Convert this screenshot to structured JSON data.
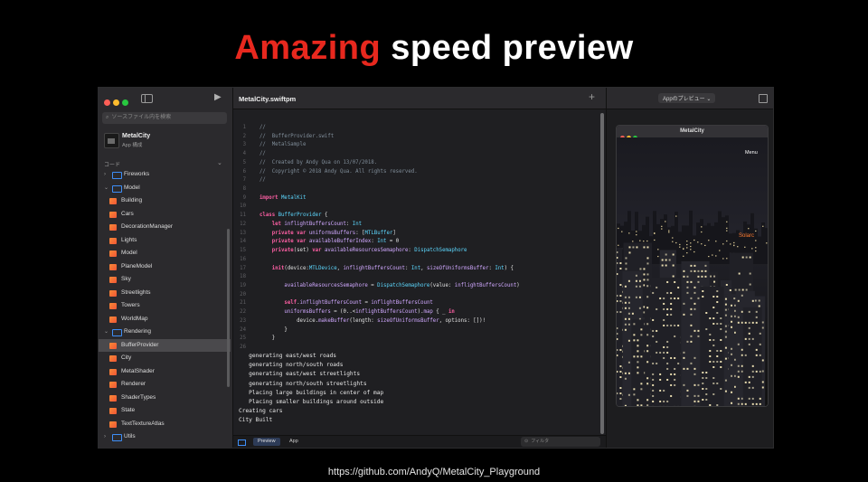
{
  "slide": {
    "title_accent": "Amazing",
    "title_rest": "speed preview",
    "footer_url": "https://github.com/AndyQ/MetalCity_Playground"
  },
  "sidebar": {
    "search_placeholder": "ソースファイル内を検索",
    "project_name": "MetalCity",
    "project_subtitle": "App 構成",
    "section_label": "コード",
    "items": [
      {
        "label": "Fireworks",
        "kind": "folder",
        "level": 1,
        "expanded": false
      },
      {
        "label": "Model",
        "kind": "folder",
        "level": 1,
        "expanded": true
      },
      {
        "label": "Building",
        "kind": "swift",
        "level": 2
      },
      {
        "label": "Cars",
        "kind": "swift",
        "level": 2
      },
      {
        "label": "DecorationManager",
        "kind": "swift",
        "level": 2
      },
      {
        "label": "Lights",
        "kind": "swift",
        "level": 2
      },
      {
        "label": "Model",
        "kind": "swift",
        "level": 2
      },
      {
        "label": "PlaneModel",
        "kind": "swift",
        "level": 2
      },
      {
        "label": "Sky",
        "kind": "swift",
        "level": 2
      },
      {
        "label": "Streetlights",
        "kind": "swift",
        "level": 2
      },
      {
        "label": "Towers",
        "kind": "swift",
        "level": 2
      },
      {
        "label": "WorldMap",
        "kind": "swift",
        "level": 2
      },
      {
        "label": "Rendering",
        "kind": "folder",
        "level": 1,
        "expanded": true
      },
      {
        "label": "BufferProvider",
        "kind": "swift",
        "level": 2,
        "selected": true
      },
      {
        "label": "City",
        "kind": "swift",
        "level": 2
      },
      {
        "label": "MetalShader",
        "kind": "swift",
        "level": 2
      },
      {
        "label": "Renderer",
        "kind": "swift",
        "level": 2
      },
      {
        "label": "ShaderTypes",
        "kind": "swift",
        "level": 2
      },
      {
        "label": "State",
        "kind": "swift",
        "level": 2
      },
      {
        "label": "TextTextureAtlas",
        "kind": "swift",
        "level": 2
      },
      {
        "label": "Utils",
        "kind": "folder",
        "level": 1,
        "expanded": false
      }
    ]
  },
  "editor": {
    "title": "MetalCity.swiftpm",
    "lines": [
      {
        "n": "1",
        "t": "//",
        "c": "cm"
      },
      {
        "n": "2",
        "t": "//  BufferProvider.swift",
        "c": "cm"
      },
      {
        "n": "3",
        "t": "//  MetalSample",
        "c": "cm"
      },
      {
        "n": "4",
        "t": "//",
        "c": "cm"
      },
      {
        "n": "5",
        "t": "//  Created by Andy Qua on 13/07/2018.",
        "c": "cm"
      },
      {
        "n": "6",
        "t": "//  Copyright © 2018 Andy Qua. All rights reserved.",
        "c": "cm"
      },
      {
        "n": "7",
        "t": "//",
        "c": "cm"
      },
      {
        "n": "8",
        "t": "",
        "c": ""
      },
      {
        "n": "9",
        "t": "import MetalKit",
        "c": "import"
      },
      {
        "n": "10",
        "t": "",
        "c": ""
      },
      {
        "n": "11",
        "t": "class BufferProvider {",
        "c": "class"
      },
      {
        "n": "12",
        "t": "    let inflightBuffersCount: Int",
        "c": "let"
      },
      {
        "n": "13",
        "t": "    private var uniformsBuffers: [MTLBuffer]",
        "c": "pv1"
      },
      {
        "n": "14",
        "t": "    private var availableBufferIndex: Int = 0",
        "c": "pv2"
      },
      {
        "n": "15",
        "t": "    private(set) var availableResourcesSemaphore: DispatchSemaphore",
        "c": "pv3"
      },
      {
        "n": "16",
        "t": "",
        "c": ""
      },
      {
        "n": "17",
        "t": "    init(device:MTLDevice, inflightBuffersCount: Int, sizeOfUniformsBuffer: Int) {",
        "c": "init"
      },
      {
        "n": "18",
        "t": "",
        "c": ""
      },
      {
        "n": "19",
        "t": "        availableResourcesSemaphore = DispatchSemaphore(value: inflightBuffersCount)",
        "c": "sem"
      },
      {
        "n": "20",
        "t": "",
        "c": ""
      },
      {
        "n": "21",
        "t": "        self.inflightBuffersCount = inflightBuffersCount",
        "c": "self"
      },
      {
        "n": "22",
        "t": "        uniformsBuffers = (0..<inflightBuffersCount).map { _ in",
        "c": "map"
      },
      {
        "n": "23",
        "t": "            device.makeBuffer(length: sizeOfUniformsBuffer, options: [])!",
        "c": "make"
      },
      {
        "n": "24",
        "t": "        }",
        "c": ""
      },
      {
        "n": "25",
        "t": "    }",
        "c": ""
      },
      {
        "n": "26",
        "t": "",
        "c": ""
      }
    ],
    "console": [
      "   generating east/west roads",
      "   generating north/south roads",
      "   generating east/west streetlights",
      "   generating north/south streetlights",
      "   Placing large buildings in center of map",
      "   Placing smaller buildings around outside",
      "Creating cars",
      "City Built"
    ],
    "bottom": {
      "preview_tab": "Preview",
      "app_tab": "App",
      "filter_placeholder": "フィルタ"
    }
  },
  "preview": {
    "dropdown_label": "Appのプレビュー",
    "window_title": "MetalCity",
    "menu_label": "Menu",
    "overlay_text": "Solarc"
  },
  "colors": {
    "accent": "#e8281e",
    "keyword": "#fc5fa3",
    "type": "#5dd8ff",
    "property": "#d0a8ff",
    "comment": "#7f8c98"
  }
}
